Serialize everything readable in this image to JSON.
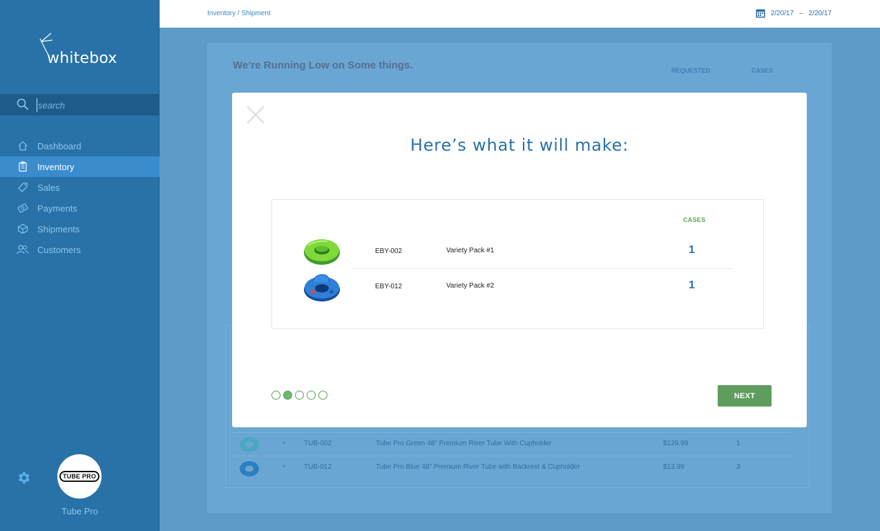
{
  "sidebar": {
    "logo_text": "whitebox",
    "search_placeholder": "search",
    "nav": [
      {
        "label": "Dashboard",
        "icon": "home-icon",
        "active": false
      },
      {
        "label": "Inventory",
        "icon": "clipboard-icon",
        "active": true
      },
      {
        "label": "Sales",
        "icon": "tag-icon",
        "active": false
      },
      {
        "label": "Payments",
        "icon": "payments-icon",
        "active": false
      },
      {
        "label": "Shipments",
        "icon": "box-icon",
        "active": false
      },
      {
        "label": "Customers",
        "icon": "users-icon",
        "active": false
      }
    ],
    "avatar_text": "TUBE PRO",
    "brand_name": "Tube Pro"
  },
  "topbar": {
    "breadcrumb": "Inventory / Shipment",
    "date_from": "2/20/17",
    "date_sep": "–",
    "date_to": "2/20/17"
  },
  "background": {
    "heading": "We’re Running Low on Some things.",
    "col_requested": "REQUESTED",
    "col_cases": "CASES",
    "rows": [
      {
        "plus": "+",
        "sku": "TUB-002",
        "name": "Tube Pro Green 48\" Premium River Tube With Cupholder",
        "price": "$129.99",
        "qty": "1"
      },
      {
        "plus": "+",
        "sku": "TUB-012",
        "name": "Tube Pro Blue 48\" Premium River Tube with Backrest & Cupholder",
        "price": "$13.99",
        "qty": "3"
      }
    ]
  },
  "modal": {
    "title": "Here’s what it will make:",
    "cases_header": "CASES",
    "items": [
      {
        "sku": "EBY-002",
        "name": "Variety Pack #1",
        "qty": "1",
        "thumb": "green-tube-image"
      },
      {
        "sku": "EBY-012",
        "name": "Variety Pack #2",
        "qty": "1",
        "thumb": "blue-tube-image"
      }
    ],
    "steps_total": 5,
    "current_step": 2,
    "next_label": "NEXT"
  },
  "colors": {
    "sidebar": "#2872a8",
    "active_nav": "#3a8ccd",
    "accent_green": "#5e9d5e",
    "title_blue": "#2872a8"
  }
}
